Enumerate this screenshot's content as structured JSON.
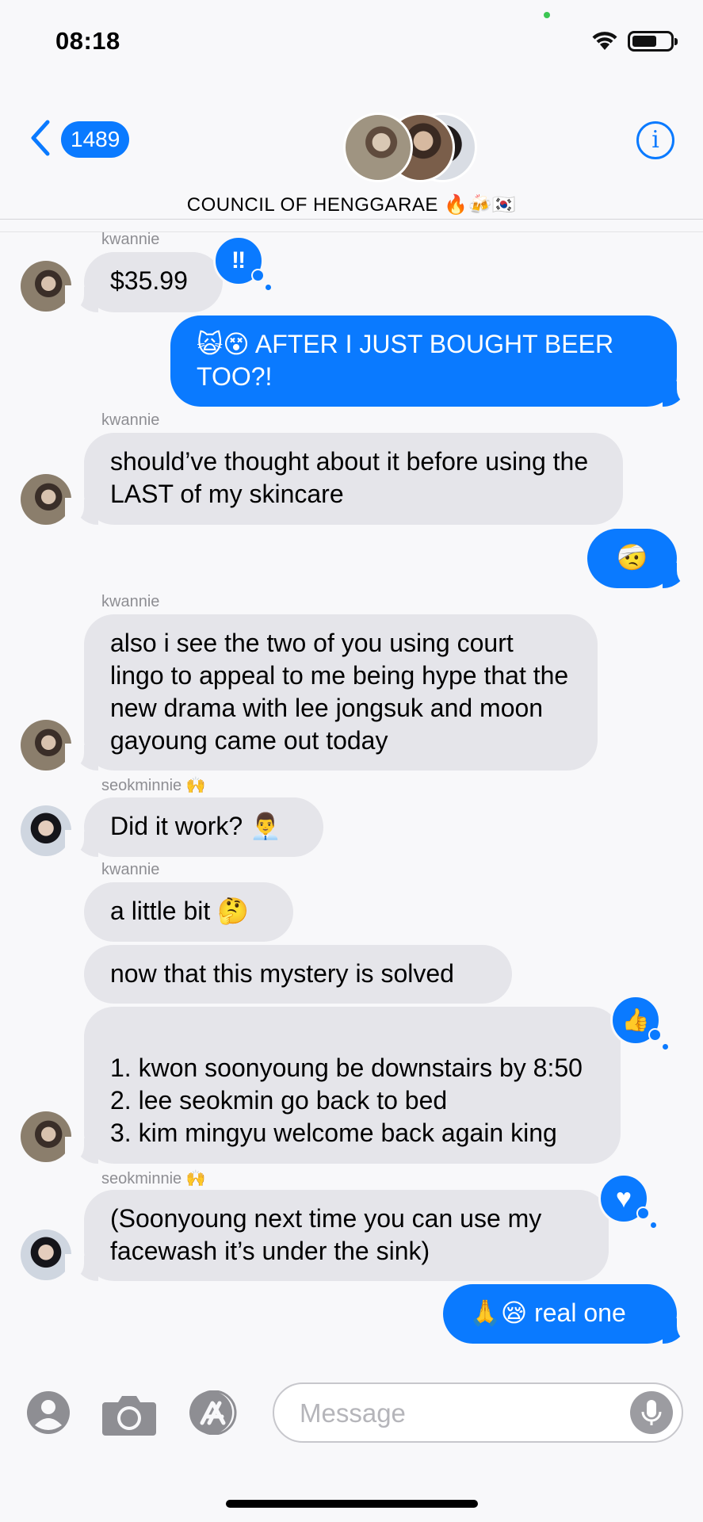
{
  "status_bar": {
    "time": "08:18"
  },
  "header": {
    "back_count": "1489",
    "group_name": "COUNCIL OF HENGGARAE 🔥🍻🇰🇷",
    "info_label": "i"
  },
  "messages": [
    {
      "sender": "kwannie",
      "text": "$35.99",
      "tapback": "‼"
    },
    {
      "text": "🙀😵 AFTER I JUST BOUGHT BEER TOO?!"
    },
    {
      "sender": "kwannie",
      "text": "should’ve thought about it before using the LAST of my skincare"
    },
    {
      "text": "🤕"
    },
    {
      "sender": "kwannie",
      "text": "also i see the two of you using court lingo to appeal to me being hype that the new drama with lee jongsuk and moon gayoung came out today"
    },
    {
      "sender": "seokminnie 🙌",
      "text": "Did it work? 👨‍💼"
    },
    {
      "sender": "kwannie",
      "text": "a little bit 🤔"
    },
    {
      "text": "now that this mystery is solved"
    },
    {
      "text": "1. kwon soonyoung be downstairs by 8:50\n2. lee seokmin go back to bed\n3. kim mingyu welcome back again king",
      "tapback": "👍"
    },
    {
      "sender": "seokminnie 🙌",
      "text": "(Soonyoung next time you can use my facewash it’s under the sink)",
      "tapback": "♥"
    },
    {
      "text": "🙏😪 real one"
    }
  ],
  "input": {
    "placeholder": "Message"
  },
  "colors": {
    "accent": "#0a7aff",
    "received_bubble": "#e5e5ea",
    "background": "#f8f8fa"
  }
}
